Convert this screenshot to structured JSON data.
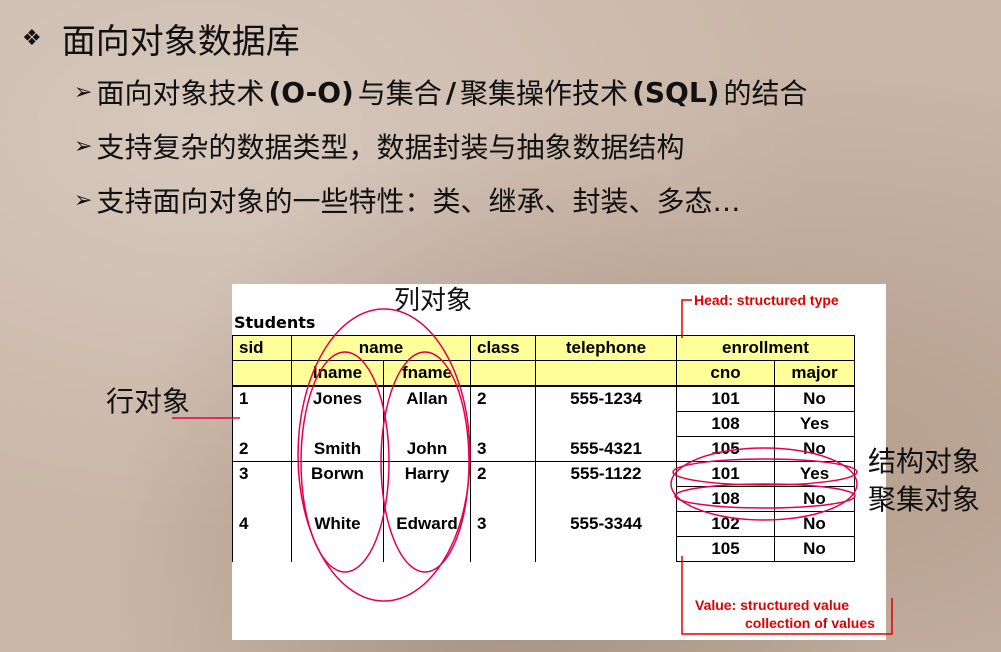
{
  "title": {
    "text": "面向对象数据库",
    "icon": "diamond-bullet-icon"
  },
  "bullets": [
    {
      "parts": [
        "面向对象技术",
        "(O-O)",
        "与集合",
        "/",
        "聚集操作技术",
        "(SQL)",
        "的结合"
      ]
    },
    {
      "text": "支持复杂的数据类型，数据封装与抽象数据结构"
    },
    {
      "text": "支持面向对象的一些特性：类、继承、封装、多态…"
    }
  ],
  "table": {
    "caption": "Students",
    "headers": {
      "sid": "sid",
      "name": "name",
      "class": "class",
      "telephone": "telephone",
      "enrollment": "enrollment",
      "lname": "lname",
      "fname": "fname",
      "cno": "cno",
      "major": "major"
    },
    "rows": [
      {
        "sid": "1",
        "lname": "Jones",
        "fname": "Allan",
        "class": "2",
        "telephone": "555-1234",
        "enrollment": [
          {
            "cno": "101",
            "major": "No"
          },
          {
            "cno": "108",
            "major": "Yes"
          }
        ]
      },
      {
        "sid": "2",
        "lname": "Smith",
        "fname": "John",
        "class": "3",
        "telephone": "555-4321",
        "enrollment": [
          {
            "cno": "105",
            "major": "No"
          }
        ]
      },
      {
        "sid": "3",
        "lname": "Borwn",
        "fname": "Harry",
        "class": "2",
        "telephone": "555-1122",
        "enrollment": [
          {
            "cno": "101",
            "major": "Yes"
          },
          {
            "cno": "108",
            "major": "No"
          }
        ]
      },
      {
        "sid": "4",
        "lname": "White",
        "fname": "Edward",
        "class": "3",
        "telephone": "555-3344",
        "enrollment": [
          {
            "cno": "102",
            "major": "No"
          },
          {
            "cno": "105",
            "major": "No"
          }
        ]
      }
    ]
  },
  "annotations": {
    "column_object": "列对象",
    "row_object": "行对象",
    "structure_object": "结构对象",
    "collection_object": "聚集对象",
    "head_note": "Head: structured type",
    "value_note_line1": "Value: structured value",
    "value_note_line2": "collection of values"
  },
  "colors": {
    "header_fill": "#ffff99",
    "annotation_red": "#e00000",
    "circle_red": "#e6004c"
  }
}
